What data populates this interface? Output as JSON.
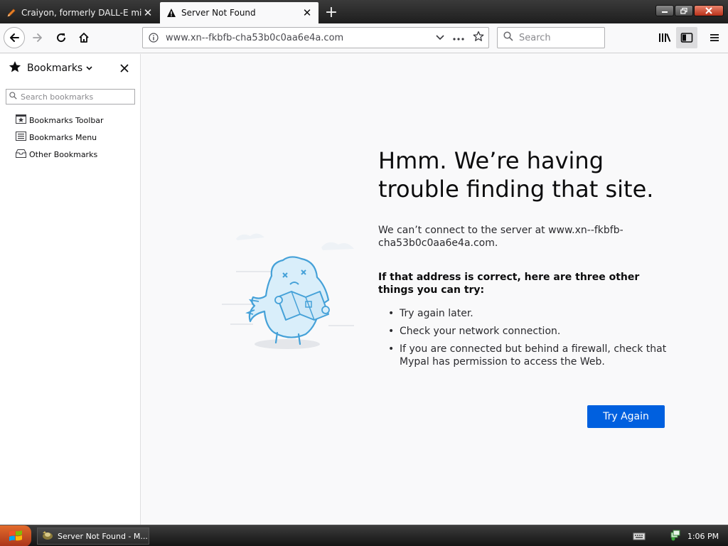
{
  "tabs": [
    {
      "title": "Craiyon, formerly DALL-E mini",
      "icon": "pencil-icon",
      "active": false
    },
    {
      "title": "Server Not Found",
      "icon": "warning-icon",
      "active": true
    }
  ],
  "toolbar": {
    "url": "www.xn--fkbfb-cha53b0c0aa6e4a.com",
    "search_placeholder": "Search"
  },
  "sidebar": {
    "title": "Bookmarks",
    "search_placeholder": "Search bookmarks",
    "items": [
      {
        "label": "Bookmarks Toolbar",
        "icon": "bookmarks-toolbar-icon"
      },
      {
        "label": "Bookmarks Menu",
        "icon": "bookmarks-menu-icon"
      },
      {
        "label": "Other Bookmarks",
        "icon": "other-bookmarks-icon"
      }
    ]
  },
  "error": {
    "title": "Hmm. We’re having trouble finding that site.",
    "description": "We can’t connect to the server at www.xn--fkbfb-cha53b0c0aa6e4a.com.",
    "suggestions_heading": "If that address is correct, here are three other things you can try:",
    "suggestions": [
      "Try again later.",
      "Check your network connection.",
      "If you are connected but behind a firewall, check that Mypal has permission to access the Web."
    ],
    "button_label": "Try Again"
  },
  "taskbar": {
    "task_label": "Server Not Found - M...",
    "clock": "1:06 PM"
  },
  "colors": {
    "accent": "#0060df",
    "page_background": "#f9f9fa",
    "illustration_stroke": "#45a1d8",
    "illustration_fill": "#d9eefa"
  }
}
